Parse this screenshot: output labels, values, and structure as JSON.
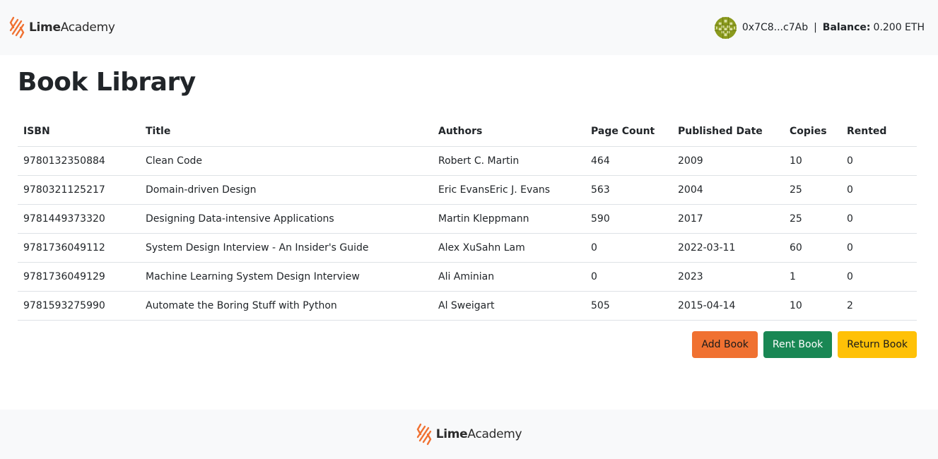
{
  "brand": {
    "name_bold": "Lime",
    "name_light": "Academy",
    "accent_color": "#f07131"
  },
  "account": {
    "avatar_icon": "identicon-avatar",
    "address": "0x7C8...c7Ab",
    "separator": "|",
    "balance_label": "Balance:",
    "balance_value": "0.200 ETH"
  },
  "page": {
    "title": "Book Library"
  },
  "table": {
    "headers": [
      "ISBN",
      "Title",
      "Authors",
      "Page Count",
      "Published Date",
      "Copies",
      "Rented"
    ],
    "rows": [
      [
        "9780132350884",
        "Clean Code",
        "Robert C. Martin",
        "464",
        "2009",
        "10",
        "0"
      ],
      [
        "9780321125217",
        "Domain-driven Design",
        "Eric EvansEric J. Evans",
        "563",
        "2004",
        "25",
        "0"
      ],
      [
        "9781449373320",
        "Designing Data-intensive Applications",
        "Martin Kleppmann",
        "590",
        "2017",
        "25",
        "0"
      ],
      [
        "9781736049112",
        "System Design Interview - An Insider's Guide",
        "Alex XuSahn Lam",
        "0",
        "2022-03-11",
        "60",
        "0"
      ],
      [
        "9781736049129",
        "Machine Learning System Design Interview",
        "Ali Aminian",
        "0",
        "2023",
        "1",
        "0"
      ],
      [
        "9781593275990",
        "Automate the Boring Stuff with Python",
        "Al Sweigart",
        "505",
        "2015-04-14",
        "10",
        "2"
      ]
    ]
  },
  "actions": {
    "add_label": "Add Book",
    "rent_label": "Rent Book",
    "return_label": "Return Book",
    "add_color": "#f07131",
    "rent_color": "#198754",
    "return_color": "#ffc107"
  },
  "footer": {
    "name_bold": "Lime",
    "name_light": "Academy"
  }
}
